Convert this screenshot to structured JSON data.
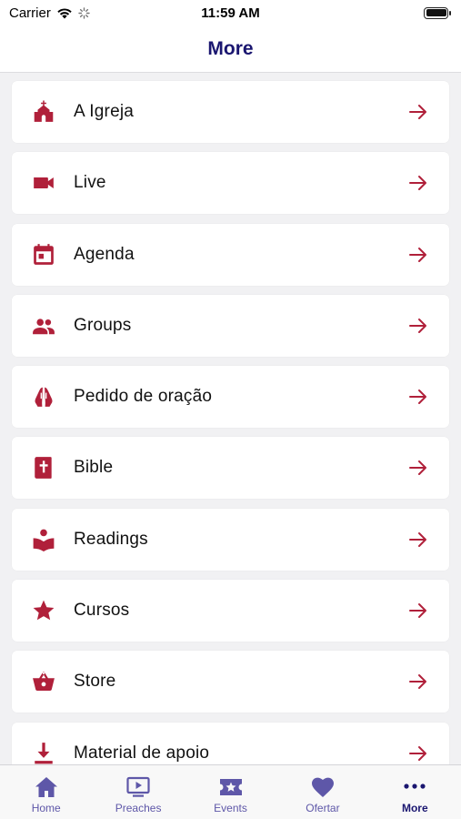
{
  "status_bar": {
    "carrier": "Carrier",
    "time": "11:59 AM"
  },
  "header": {
    "title": "More"
  },
  "colors": {
    "accent": "#b0203a",
    "title": "#1a1670",
    "tab_inactive": "#5e57a8"
  },
  "menu": {
    "items": [
      {
        "label": "A Igreja",
        "icon": "church-icon"
      },
      {
        "label": "Live",
        "icon": "video-camera-icon"
      },
      {
        "label": "Agenda",
        "icon": "calendar-icon"
      },
      {
        "label": "Groups",
        "icon": "people-icon"
      },
      {
        "label": "Pedido de oração",
        "icon": "praying-hands-icon"
      },
      {
        "label": "Bible",
        "icon": "bible-icon"
      },
      {
        "label": "Readings",
        "icon": "reading-icon"
      },
      {
        "label": "Cursos",
        "icon": "star-icon"
      },
      {
        "label": "Store",
        "icon": "basket-icon"
      },
      {
        "label": "Material de apoio",
        "icon": "download-icon"
      }
    ]
  },
  "tab_bar": {
    "tabs": [
      {
        "label": "Home",
        "icon": "home-icon"
      },
      {
        "label": "Preaches",
        "icon": "play-screen-icon"
      },
      {
        "label": "Events",
        "icon": "ticket-star-icon"
      },
      {
        "label": "Ofertar",
        "icon": "heart-icon"
      },
      {
        "label": "More",
        "icon": "more-dots-icon",
        "active": true
      }
    ]
  }
}
